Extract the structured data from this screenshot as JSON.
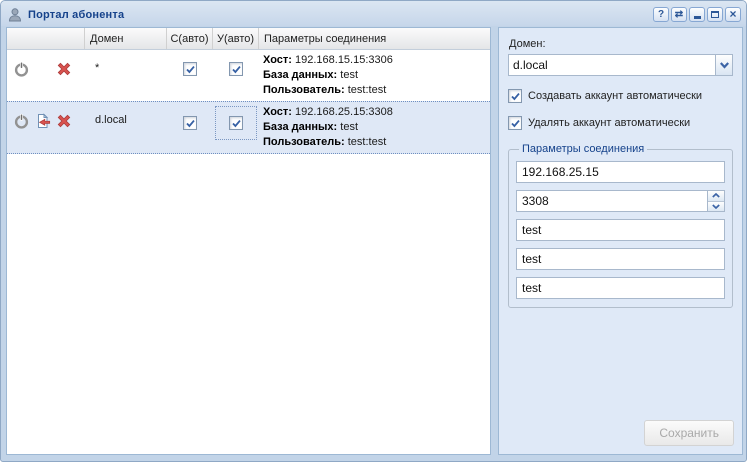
{
  "window": {
    "title": "Портал абонента",
    "tools": {
      "help_glyph": "?",
      "refresh_glyph": "⇄",
      "close_glyph": "×",
      "names": [
        "help",
        "refresh",
        "minimize",
        "maximize",
        "close"
      ]
    }
  },
  "grid": {
    "headers": {
      "actions": "",
      "domain": "Домен",
      "create_auto": "С(авто)",
      "delete_auto": "У(авто)",
      "params": "Параметры соединения"
    },
    "rows": [
      {
        "domain": "*",
        "icons": [
          "power",
          "delete"
        ],
        "create_auto_checked": true,
        "delete_auto_checked": true,
        "selected": false,
        "params": {
          "host_label": "Хост:",
          "host": "192.168.15.15:3306",
          "db_label": "База данных:",
          "db": "test",
          "user_label": "Пользователь:",
          "user": "test:test"
        }
      },
      {
        "domain": "d.local",
        "icons": [
          "power",
          "revert-changes",
          "delete"
        ],
        "create_auto_checked": true,
        "delete_auto_checked": true,
        "selected": true,
        "params": {
          "host_label": "Хост:",
          "host": "192.168.25.15:3308",
          "db_label": "База данных:",
          "db": "test",
          "user_label": "Пользователь:",
          "user": "test:test"
        }
      }
    ]
  },
  "form": {
    "domain_label": "Домен:",
    "domain_value": "d.local",
    "create_checkbox_label": "Создавать аккаунт автоматически",
    "create_checked": true,
    "delete_checkbox_label": "Удалять аккаунт автоматически",
    "delete_checked": true,
    "fieldset_title": "Параметры соединения",
    "host_value": "192.168.25.15",
    "port_value": "3308",
    "db_value": "test",
    "user_value": "test",
    "password_value": "test",
    "save_label": "Сохранить",
    "save_enabled": false
  },
  "colors": {
    "title_text": "#15428b",
    "selection_bg": "#dfe8f6",
    "panel_bg": "#dfe9f7",
    "frame_bg": "#c2d4e8",
    "panel_border": "#9db8d4",
    "delete_icon": "#d9534f",
    "accent_blue": "#3c64a6"
  }
}
